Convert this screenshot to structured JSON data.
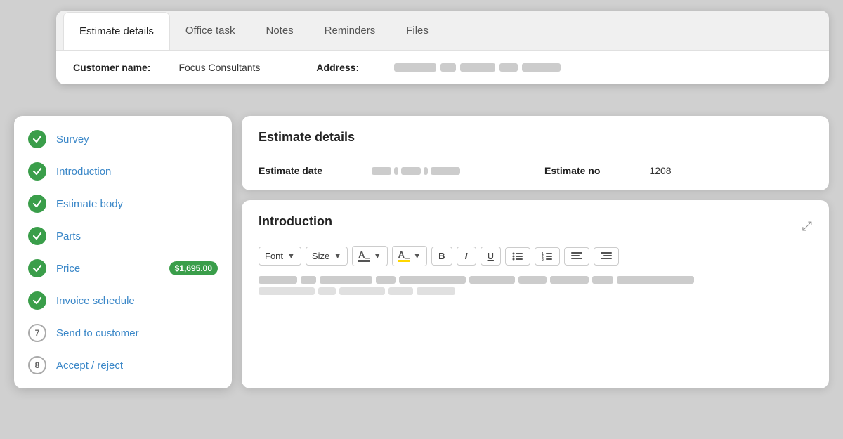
{
  "topCard": {
    "tabs": [
      {
        "id": "estimate-details",
        "label": "Estimate details",
        "active": true
      },
      {
        "id": "office-task",
        "label": "Office task",
        "active": false
      },
      {
        "id": "notes",
        "label": "Notes",
        "active": false
      },
      {
        "id": "reminders",
        "label": "Reminders",
        "active": false
      },
      {
        "id": "files",
        "label": "Files",
        "active": false
      }
    ],
    "customerLabel": "Customer name:",
    "customerValue": "Focus Consultants",
    "addressLabel": "Address:"
  },
  "sidebar": {
    "items": [
      {
        "id": "survey",
        "label": "Survey",
        "checked": true,
        "number": null,
        "badge": null
      },
      {
        "id": "introduction",
        "label": "Introduction",
        "checked": true,
        "number": null,
        "badge": null
      },
      {
        "id": "estimate-body",
        "label": "Estimate body",
        "checked": true,
        "number": null,
        "badge": null
      },
      {
        "id": "parts",
        "label": "Parts",
        "checked": true,
        "number": null,
        "badge": null
      },
      {
        "id": "price",
        "label": "Price",
        "checked": true,
        "number": null,
        "badge": "$1,695.00"
      },
      {
        "id": "invoice-schedule",
        "label": "Invoice schedule",
        "checked": true,
        "number": null,
        "badge": null
      },
      {
        "id": "send-to-customer",
        "label": "Send to customer",
        "checked": false,
        "number": 7,
        "badge": null
      },
      {
        "id": "accept-reject",
        "label": "Accept / reject",
        "checked": false,
        "number": 8,
        "badge": null
      }
    ]
  },
  "estimateDetails": {
    "title": "Estimate details",
    "estimateDateLabel": "Estimate date",
    "estimateNoLabel": "Estimate no",
    "estimateNo": "1208"
  },
  "introduction": {
    "title": "Introduction",
    "toolbar": {
      "fontLabel": "Font",
      "sizeLabel": "Size",
      "fontColorLabel": "A_",
      "highlightLabel": "A_",
      "boldLabel": "B",
      "italicLabel": "I",
      "underlineLabel": "U"
    }
  }
}
